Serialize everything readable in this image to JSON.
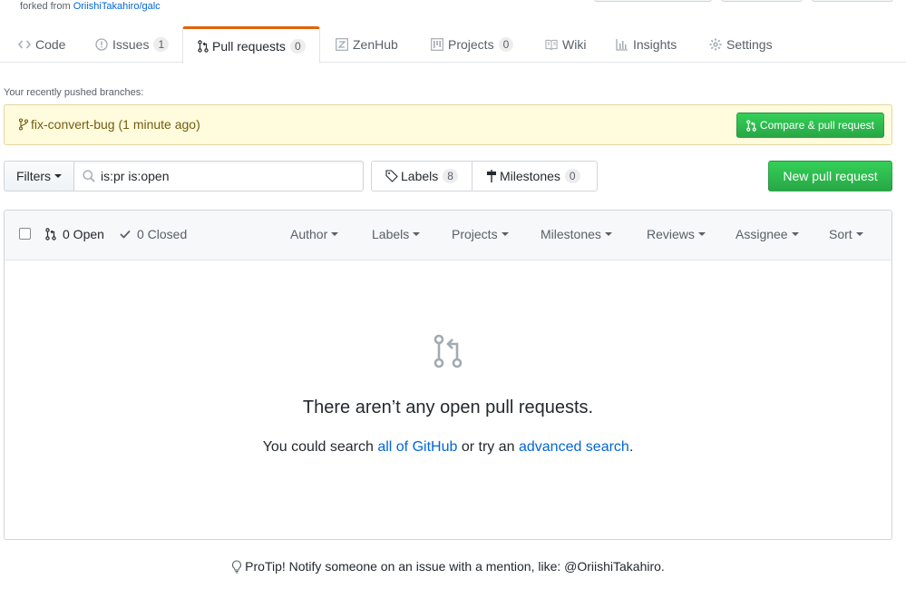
{
  "repo": {
    "forked_from_prefix": "forked from",
    "forked_from_link": "OriishiTakahiro/galc"
  },
  "tabs": [
    {
      "label": "Code",
      "icon": "code-icon"
    },
    {
      "label": "Issues",
      "count": "1",
      "icon": "issue-icon"
    },
    {
      "label": "Pull requests",
      "count": "0",
      "icon": "pull-request-icon",
      "selected": true
    },
    {
      "label": "ZenHub",
      "icon": "zenhub-icon"
    },
    {
      "label": "Projects",
      "count": "0",
      "icon": "project-icon"
    },
    {
      "label": "Wiki",
      "icon": "book-icon"
    },
    {
      "label": "Insights",
      "icon": "graph-icon"
    },
    {
      "label": "Settings",
      "icon": "gear-icon"
    }
  ],
  "recent_branches": {
    "label": "Your recently pushed branches:",
    "branch_name": "fix-convert-bug",
    "branch_time": "(1 minute ago)",
    "compare_button": "Compare & pull request"
  },
  "filter_bar": {
    "filters_label": "Filters",
    "search_value": "is:pr is:open",
    "labels_label": "Labels",
    "labels_count": "8",
    "milestones_label": "Milestones",
    "milestones_count": "0",
    "new_pr_button": "New pull request"
  },
  "list_header": {
    "open_label": "0 Open",
    "closed_label": "0 Closed",
    "filters": [
      "Author",
      "Labels",
      "Projects",
      "Milestones",
      "Reviews",
      "Assignee",
      "Sort"
    ]
  },
  "blankslate": {
    "title": "There aren’t any open pull requests.",
    "text_before": "You could search",
    "link1": "all of GitHub",
    "text_middle": "or try an",
    "link2": "advanced search",
    "text_after": "."
  },
  "protip": {
    "text": "ProTip! Notify someone on an issue with a mention, like: @OriishiTakahiro."
  },
  "colors": {
    "accent_orange": "#e36209",
    "green_button": "#28a745",
    "link_blue": "#0366d6",
    "notice_yellow": "#fffbdd"
  }
}
